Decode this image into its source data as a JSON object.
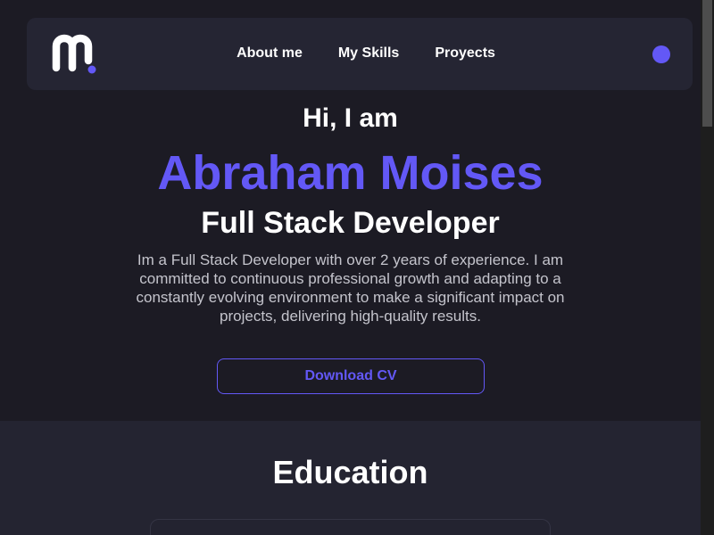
{
  "brand": {
    "logo_icon": "m-logo-icon",
    "logo_letter": "m",
    "accent_color": "#6358f6"
  },
  "nav": {
    "items": [
      {
        "label": "About me"
      },
      {
        "label": "My Skills"
      },
      {
        "label": "Proyects"
      }
    ],
    "theme_toggle_icon": "circle-dot-icon"
  },
  "hero": {
    "greeting": "Hi, I am",
    "name": "Abraham Moises",
    "role": "Full Stack Developer",
    "bio": "Im a Full Stack Developer with over 2 years of experience. I am committed to continuous professional growth and adapting to a constantly evolving environment to make a significant impact on projects, delivering high-quality results.",
    "cta_label": "Download CV"
  },
  "education": {
    "title": "Education"
  },
  "colors": {
    "background": "#1c1b24",
    "navbar": "#252533",
    "section_alt": "#242431",
    "text_primary": "#ffffff",
    "text_muted": "#c4c4cc"
  }
}
